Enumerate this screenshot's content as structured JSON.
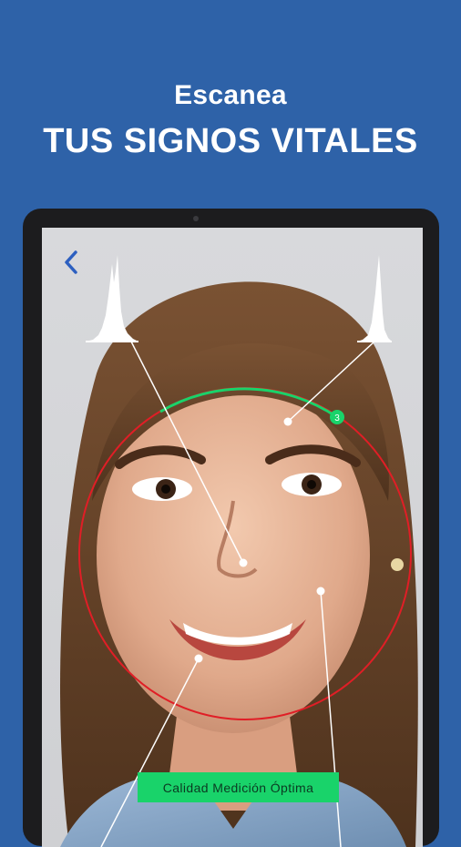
{
  "headline": {
    "line1": "Escanea",
    "line2": "TUS SIGNOS VITALES"
  },
  "screen": {
    "back_icon": "chevron-left-icon",
    "quality_label": "Calidad Medición Óptima",
    "progress_badge": "3",
    "scan_ring": {
      "progress_fraction": 0.22,
      "colors": {
        "pending": "#e01e26",
        "complete": "#19d36a"
      }
    },
    "colors": {
      "back_icon": "#2d5fc0",
      "badge": "#19d36a"
    }
  }
}
